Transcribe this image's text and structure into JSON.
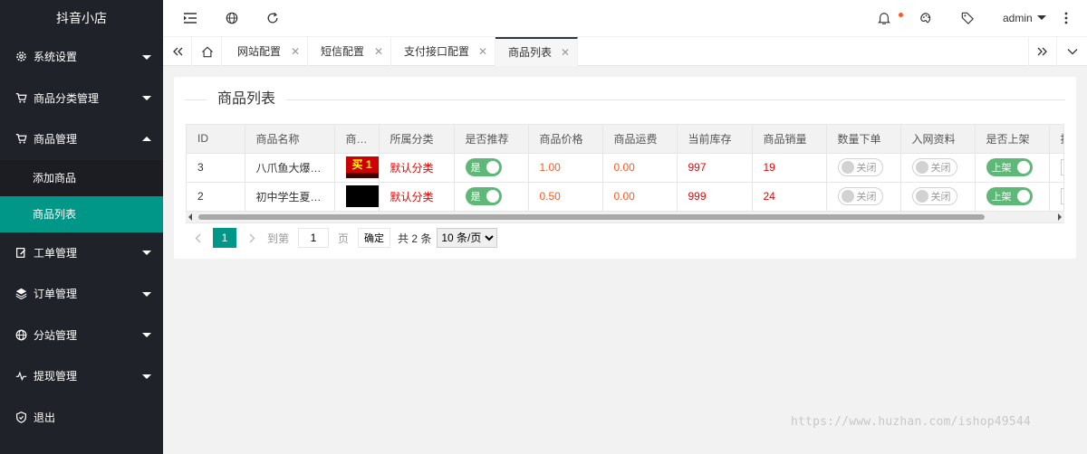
{
  "sidebar": {
    "logo": "抖音小店",
    "items": [
      {
        "label": "系统设置",
        "icon": "gear-icon"
      },
      {
        "label": "商品分类管理",
        "icon": "cart-icon"
      },
      {
        "label": "商品管理",
        "icon": "cart-icon"
      },
      {
        "label": "工单管理",
        "icon": "edit-icon"
      },
      {
        "label": "订单管理",
        "icon": "layers-icon"
      },
      {
        "label": "分站管理",
        "icon": "globe-icon"
      },
      {
        "label": "提现管理",
        "icon": "pulse-icon"
      },
      {
        "label": "退出",
        "icon": "shield-icon"
      }
    ],
    "sub_items": [
      {
        "label": "添加商品"
      },
      {
        "label": "商品列表"
      }
    ]
  },
  "header": {
    "user": "admin"
  },
  "tabs": [
    {
      "label": "网站配置"
    },
    {
      "label": "短信配置"
    },
    {
      "label": "支付接口配置"
    },
    {
      "label": "商品列表"
    }
  ],
  "card": {
    "title": "商品列表"
  },
  "table": {
    "columns": [
      "ID",
      "商品名称",
      "商…",
      "所属分类",
      "是否推荐",
      "商品价格",
      "商品运费",
      "当前库存",
      "商品销量",
      "数量下单",
      "入网资料",
      "是否上架",
      "排"
    ],
    "rows": [
      {
        "id": "3",
        "name": "八爪鱼大爆…",
        "thumb_text": "买 1",
        "category": "默认分类",
        "recommend": "是",
        "price": "1.00",
        "shipping": "0.00",
        "stock": "997",
        "sales": "19",
        "qty_order": "关闭",
        "network": "关闭",
        "on_sale": "上架"
      },
      {
        "id": "2",
        "name": "初中学生夏…",
        "thumb_text": "",
        "category": "默认分类",
        "recommend": "是",
        "price": "0.50",
        "shipping": "0.00",
        "stock": "999",
        "sales": "24",
        "qty_order": "关闭",
        "network": "关闭",
        "on_sale": "上架"
      }
    ]
  },
  "pager": {
    "current": "1",
    "goto_label": "到第",
    "page_input": "1",
    "page_unit": "页",
    "confirm": "确定",
    "total": "共 2 条",
    "page_size": "10 条/页"
  },
  "watermark": "https://www.huzhan.com/ishop49544",
  "colors": {
    "sidebar_bg": "#20222a",
    "accent": "#009688",
    "switch_on": "#5fb878",
    "value_red": "#ee0000",
    "value_orange": "#ff5722"
  }
}
